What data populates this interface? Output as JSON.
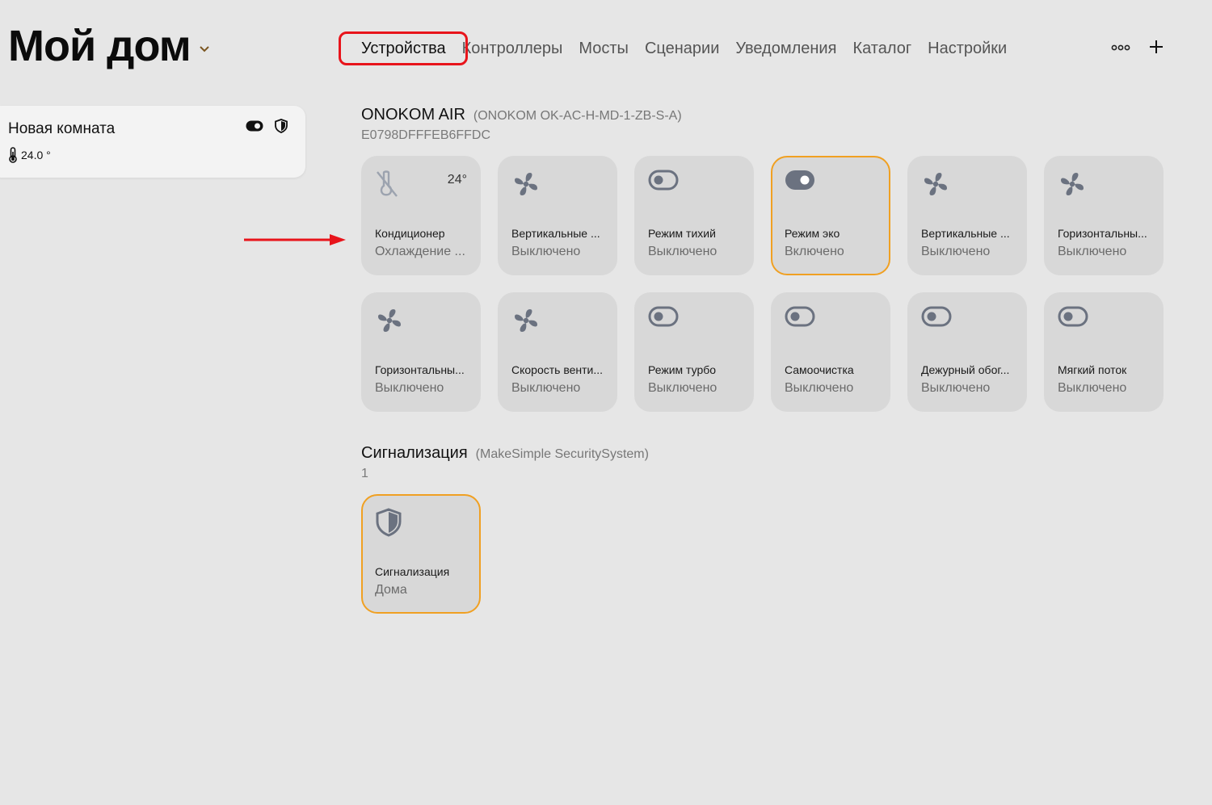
{
  "header": {
    "home_title": "Мой дом",
    "tabs": [
      "Устройства",
      "Контроллеры",
      "Мосты",
      "Сценарии",
      "Уведомления",
      "Каталог",
      "Настройки"
    ],
    "active_tab": "Устройства"
  },
  "room": {
    "name": "Новая комната",
    "temperature": "24.0 °"
  },
  "groups": [
    {
      "title": "ONOKOM AIR",
      "model": "(ONOKOM OK-AC-H-MD-1-ZB-S-A)",
      "subtitle": "E0798DFFFEB6FFDC",
      "tiles": [
        {
          "icon": "ac-off-icon",
          "name": "Кондиционер",
          "state": "Охлаждение ...",
          "temp": "24°",
          "on": false
        },
        {
          "icon": "fan-icon",
          "name": "Вертикальные ...",
          "state": "Выключено",
          "on": false
        },
        {
          "icon": "toggle-off-icon",
          "name": "Режим тихий",
          "state": "Выключено",
          "on": false
        },
        {
          "icon": "toggle-on-icon",
          "name": "Режим эко",
          "state": "Включено",
          "on": true
        },
        {
          "icon": "fan-icon",
          "name": "Вертикальные ...",
          "state": "Выключено",
          "on": false
        },
        {
          "icon": "fan-icon",
          "name": "Горизонтальны...",
          "state": "Выключено",
          "on": false
        },
        {
          "icon": "fan-icon",
          "name": "Горизонтальны...",
          "state": "Выключено",
          "on": false
        },
        {
          "icon": "fan-icon",
          "name": "Скорость венти...",
          "state": "Выключено",
          "on": false
        },
        {
          "icon": "toggle-off-icon",
          "name": "Режим турбо",
          "state": "Выключено",
          "on": false
        },
        {
          "icon": "toggle-off-icon",
          "name": "Самоочистка",
          "state": "Выключено",
          "on": false
        },
        {
          "icon": "toggle-off-icon",
          "name": "Дежурный обог...",
          "state": "Выключено",
          "on": false
        },
        {
          "icon": "toggle-off-icon",
          "name": "Мягкий поток",
          "state": "Выключено",
          "on": false
        }
      ]
    },
    {
      "title": "Сигнализация",
      "model": "(MakeSimple SecuritySystem)",
      "subtitle": "1",
      "tiles": [
        {
          "icon": "shield-icon",
          "name": "Сигнализация",
          "state": "Дома",
          "on": true
        }
      ]
    }
  ],
  "colors": {
    "background": "#e6e6e6",
    "tile": "#d8d8d8",
    "active_border": "#f0a022",
    "icon": "#6b7280",
    "annotation_red": "#e8141b"
  }
}
